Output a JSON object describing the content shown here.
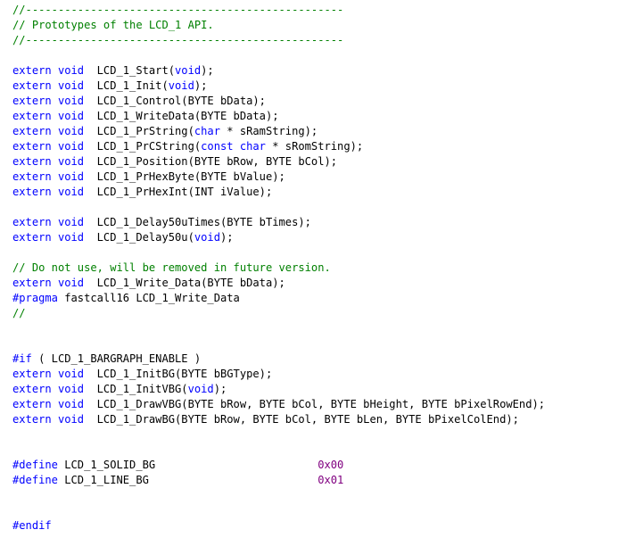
{
  "colors": {
    "comment": "#008000",
    "keyword": "#0000ff",
    "preprocessor": "#0000ff",
    "number": "#800080",
    "text": "#000000",
    "background": "#ffffff"
  },
  "lines": [
    [
      {
        "t": "c",
        "v": "//-------------------------------------------------"
      }
    ],
    [
      {
        "t": "c",
        "v": "// Prototypes of the LCD_1 API."
      }
    ],
    [
      {
        "t": "c",
        "v": "//-------------------------------------------------"
      }
    ],
    [],
    [
      {
        "t": "k",
        "v": "extern void"
      },
      {
        "t": "p",
        "v": "  LCD_1_Start("
      },
      {
        "t": "k",
        "v": "void"
      },
      {
        "t": "p",
        "v": ");"
      }
    ],
    [
      {
        "t": "k",
        "v": "extern void"
      },
      {
        "t": "p",
        "v": "  LCD_1_Init("
      },
      {
        "t": "k",
        "v": "void"
      },
      {
        "t": "p",
        "v": ");"
      }
    ],
    [
      {
        "t": "k",
        "v": "extern void"
      },
      {
        "t": "p",
        "v": "  LCD_1_Control(BYTE bData);"
      }
    ],
    [
      {
        "t": "k",
        "v": "extern void"
      },
      {
        "t": "p",
        "v": "  LCD_1_WriteData(BYTE bData);"
      }
    ],
    [
      {
        "t": "k",
        "v": "extern void"
      },
      {
        "t": "p",
        "v": "  LCD_1_PrString("
      },
      {
        "t": "k",
        "v": "char"
      },
      {
        "t": "p",
        "v": " * sRamString);"
      }
    ],
    [
      {
        "t": "k",
        "v": "extern void"
      },
      {
        "t": "p",
        "v": "  LCD_1_PrCString("
      },
      {
        "t": "k",
        "v": "const char"
      },
      {
        "t": "p",
        "v": " * sRomString);"
      }
    ],
    [
      {
        "t": "k",
        "v": "extern void"
      },
      {
        "t": "p",
        "v": "  LCD_1_Position(BYTE bRow, BYTE bCol);"
      }
    ],
    [
      {
        "t": "k",
        "v": "extern void"
      },
      {
        "t": "p",
        "v": "  LCD_1_PrHexByte(BYTE bValue);"
      }
    ],
    [
      {
        "t": "k",
        "v": "extern void"
      },
      {
        "t": "p",
        "v": "  LCD_1_PrHexInt(INT iValue);"
      }
    ],
    [],
    [
      {
        "t": "k",
        "v": "extern void"
      },
      {
        "t": "p",
        "v": "  LCD_1_Delay50uTimes(BYTE bTimes);"
      }
    ],
    [
      {
        "t": "k",
        "v": "extern void"
      },
      {
        "t": "p",
        "v": "  LCD_1_Delay50u("
      },
      {
        "t": "k",
        "v": "void"
      },
      {
        "t": "p",
        "v": ");"
      }
    ],
    [],
    [
      {
        "t": "c",
        "v": "// Do not use, will be removed in future version."
      }
    ],
    [
      {
        "t": "k",
        "v": "extern void"
      },
      {
        "t": "p",
        "v": "  LCD_1_Write_Data(BYTE bData);"
      }
    ],
    [
      {
        "t": "r",
        "v": "#pragma"
      },
      {
        "t": "p",
        "v": " fastcall16 LCD_1_Write_Data"
      }
    ],
    [
      {
        "t": "c",
        "v": "//"
      }
    ],
    [],
    [],
    [
      {
        "t": "r",
        "v": "#if"
      },
      {
        "t": "p",
        "v": " ( LCD_1_BARGRAPH_ENABLE )"
      }
    ],
    [
      {
        "t": "k",
        "v": "extern void"
      },
      {
        "t": "p",
        "v": "  LCD_1_InitBG(BYTE bBGType);"
      }
    ],
    [
      {
        "t": "k",
        "v": "extern void"
      },
      {
        "t": "p",
        "v": "  LCD_1_InitVBG("
      },
      {
        "t": "k",
        "v": "void"
      },
      {
        "t": "p",
        "v": ");"
      }
    ],
    [
      {
        "t": "k",
        "v": "extern void"
      },
      {
        "t": "p",
        "v": "  LCD_1_DrawVBG(BYTE bRow, BYTE bCol, BYTE bHeight, BYTE bPixelRowEnd);"
      }
    ],
    [
      {
        "t": "k",
        "v": "extern void"
      },
      {
        "t": "p",
        "v": "  LCD_1_DrawBG(BYTE bRow, BYTE bCol, BYTE bLen, BYTE bPixelColEnd);"
      }
    ],
    [],
    [],
    [
      {
        "t": "r",
        "v": "#define"
      },
      {
        "t": "p",
        "v": " LCD_1_SOLID_BG                         "
      },
      {
        "t": "n",
        "v": "0x00"
      }
    ],
    [
      {
        "t": "r",
        "v": "#define"
      },
      {
        "t": "p",
        "v": " LCD_1_LINE_BG                          "
      },
      {
        "t": "n",
        "v": "0x01"
      }
    ],
    [],
    [],
    [
      {
        "t": "r",
        "v": "#endif"
      }
    ]
  ]
}
